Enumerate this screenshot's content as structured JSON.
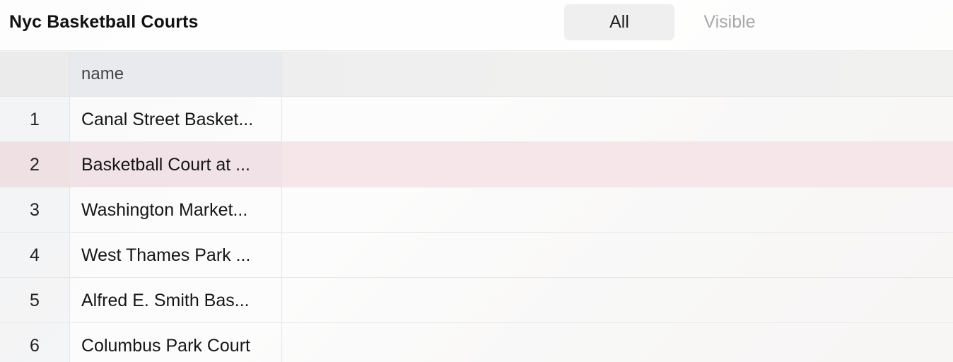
{
  "header": {
    "title": "Nyc Basketball Courts",
    "tabs": [
      {
        "label": "All",
        "active": true
      },
      {
        "label": "Visible",
        "active": false
      }
    ]
  },
  "table": {
    "columns": [
      "",
      "name"
    ],
    "rows": [
      {
        "index": "1",
        "name": "Canal Street Basket..."
      },
      {
        "index": "2",
        "name": "Basketball Court at ..."
      },
      {
        "index": "3",
        "name": "Washington Market..."
      },
      {
        "index": "4",
        "name": "West Thames Park ..."
      },
      {
        "index": "5",
        "name": "Alfred E. Smith Bas..."
      },
      {
        "index": "6",
        "name": "Columbus Park Court"
      }
    ],
    "highlighted_row": "2"
  },
  "colors": {
    "highlight": "#f6e6ea",
    "active_tab": "#efefef",
    "inactive_tab_text": "#a8a8a8"
  }
}
